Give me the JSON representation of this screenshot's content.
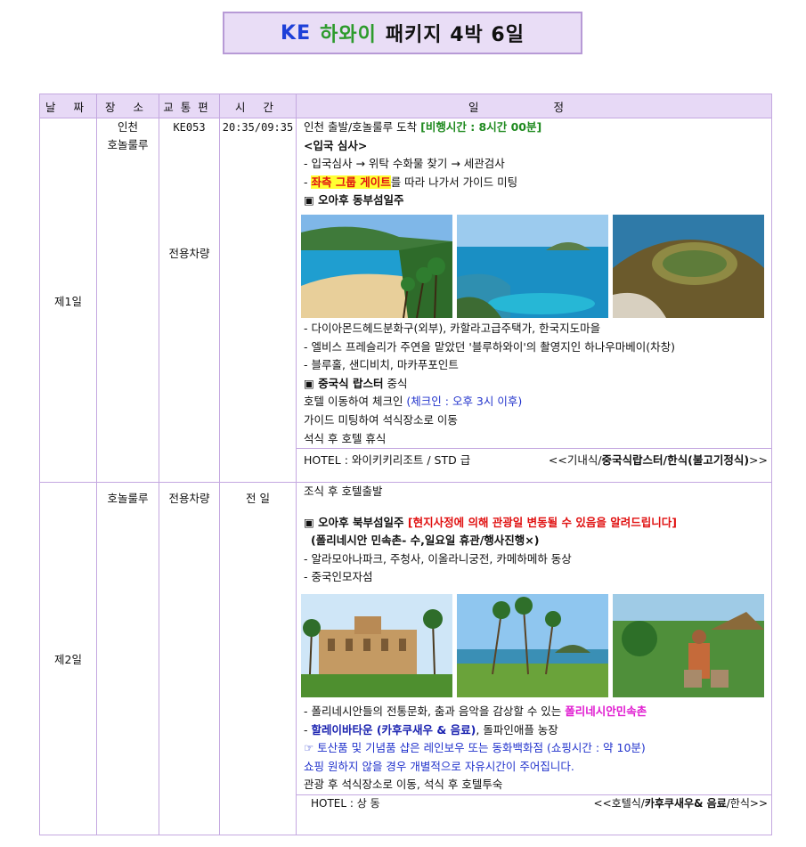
{
  "title": {
    "ke": "KE",
    "hawaii": "하와이",
    "rest": "패키지 4박 6일"
  },
  "headers": [
    "날 짜",
    "장 소",
    "교통편",
    "시 간",
    "일 정"
  ],
  "day1": {
    "day": "제1일",
    "place1": "인천",
    "place2": "호놀룰루",
    "flight": "KE053",
    "vehicle": "전용차량",
    "time": "20:35/09:35",
    "l1a": "인천 출발/호놀룰루 도착 ",
    "l1b": "[비행시간 : 8시간 00분]",
    "l2": "<입국 심사>",
    "l3": "- 입국심사 → 위탁 수화물 찾기 → 세관검사",
    "l4a": "- ",
    "l4b": "좌측 그룹 게이트",
    "l4c": "를 따라 나가서 가이드 미팅",
    "l5": "▣ 오아후 동부섬일주",
    "l6": "- 다이아몬드헤드분화구(외부), 카할라고급주택가, 한국지도마을",
    "l7": "- 엘비스 프레슬리가 주연을 맡았던 '블루하와이'의 촬영지인 하나우마베이(차창)",
    "l8": "- 블루홀, 샌디비치, 마카푸포인트",
    "l9a": "▣ 중국식 랍스터",
    "l9b": " 중식",
    "l10a": "호텔 이동하여 체크인 ",
    "l10b": "(체크인 : 오후 3시 이후)",
    "l11": "가이드 미팅하여 석식장소로 이동",
    "l12": "석식 후 호텔 휴식",
    "hotel": "HOTEL : 와이키키리조트 / STD 급",
    "meals_a": "<<기내식/",
    "meals_b": "중국식랍스터/한식(불고기정식)",
    "meals_c": ">>"
  },
  "day2": {
    "day": "제2일",
    "place": "호놀룰루",
    "vehicle": "전용차량",
    "time": "전 일",
    "l1": "조식 후 호텔출발",
    "l2a": "▣ 오아후 북부섬일주 ",
    "l2b": "[현지사정에 의해 관광일 변동될 수 있음을 알려드립니다]",
    "l3": "(폴리네시안 민속촌- 수,일요일 휴관/행사진행×)",
    "l4": "- 알라모아나파크, 주청사, 이올라니궁전, 카메하메하 동상",
    "l5": "- 중국인모자섬",
    "l6a": "- 폴리네시안들의 전통문화, 춤과 음악을 감상할 수 있는 ",
    "l6b": "폴리네시안민속촌",
    "l7a": "- ",
    "l7b": "할레이바타운 (카후쿠새우 & 음료)",
    "l7c": ", 돌파인애플 농장",
    "l8": "☞ 토산품 및 기념품 샵은 레인보우 또는 동화백화점 (쇼핑시간 : 약 10분)",
    "l9": "쇼핑 원하지 않을 경우 개별적으로 자유시간이 주어집니다.",
    "l10": "관광 후 석식장소로 이동, 석식 후 호텔투숙",
    "hotel": "HOTEL : 상 동",
    "meals_a": "<<호텔식/",
    "meals_b": "카후쿠새우& 음료",
    "meals_c": "/한식>>"
  }
}
